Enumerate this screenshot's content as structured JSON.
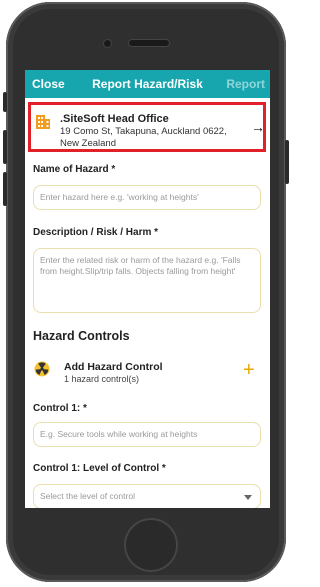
{
  "header": {
    "close_label": "Close",
    "title": "Report Hazard/Risk",
    "report_label": "Report"
  },
  "site": {
    "name": ".SiteSoft Head Office",
    "address": "19 Como St, Takapuna, Auckland 0622, New Zealand"
  },
  "hazard_name": {
    "label": "Name of Hazard *",
    "placeholder": "Enter hazard here e.g. 'working at heights'"
  },
  "description": {
    "label": "Description / Risk / Harm *",
    "placeholder": "Enter the related risk or harm of the hazard e.g. 'Falls from height.Slip/trip falls. Objects falling from height'"
  },
  "controls": {
    "section_title": "Hazard Controls",
    "add_title": "Add Hazard Control",
    "count_text": "1 hazard control(s)",
    "control1_label": "Control 1: *",
    "control1_placeholder": "E.g. Secure tools while working at heights",
    "level_label": "Control 1: Level of Control *",
    "level_placeholder": "Select the level of control"
  },
  "colors": {
    "accent": "#18a6ae",
    "highlight_border": "#e2202a",
    "icon_orange": "#f29b1d",
    "plus": "#e6a800"
  }
}
